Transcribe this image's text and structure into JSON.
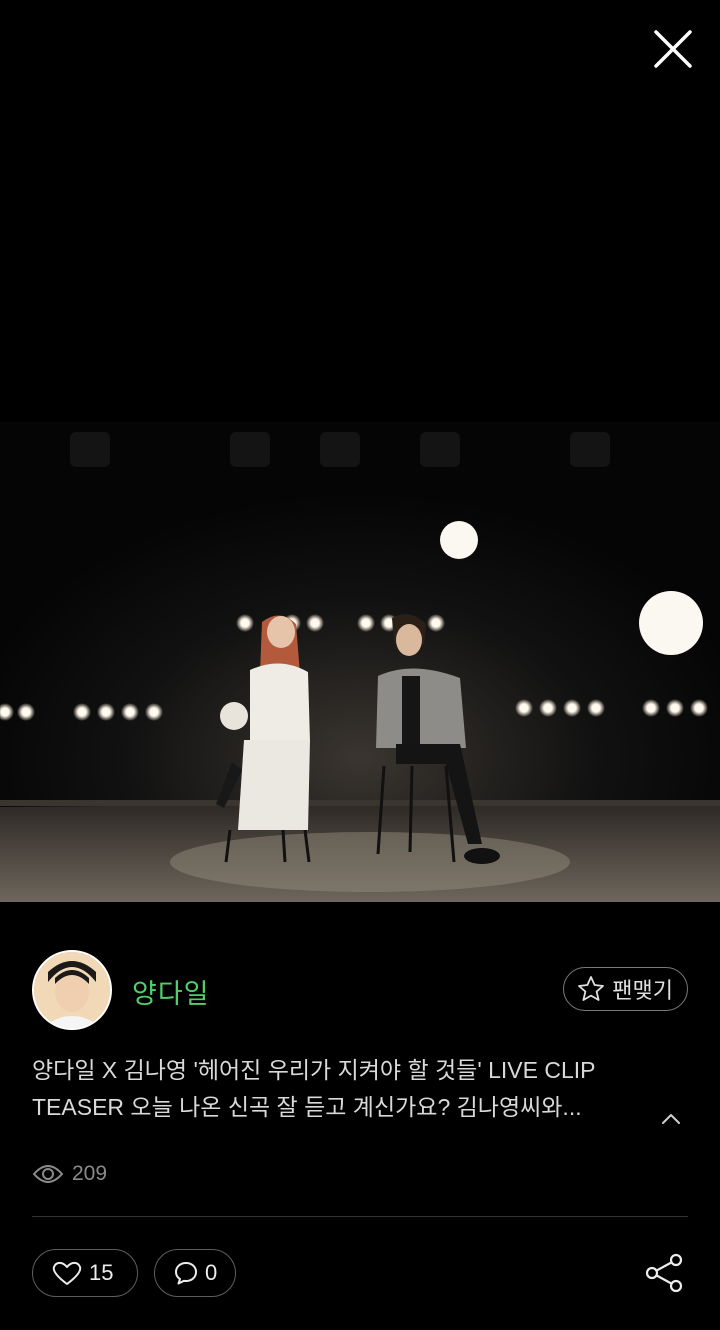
{
  "header": {
    "close_icon": "close-icon"
  },
  "post": {
    "author_name": "양다일",
    "follow_label": "팬맺기",
    "description_line1": "양다일 X 김나영 '헤어진 우리가 지켜야 할 것들' LIVE CLIP",
    "description_line2": "TEASER  오늘 나온 신곡 잘 듣고 계신가요? 김나영씨와...",
    "views": "209",
    "likes": "15",
    "comments": "0"
  },
  "colors": {
    "background": "#000000",
    "author_name": "#4fd06a",
    "text": "#d9d9d9",
    "muted": "#8a8a8a"
  },
  "icons": [
    "close-icon",
    "star-icon",
    "chevron-up-icon",
    "eye-icon",
    "heart-icon",
    "comment-icon",
    "share-icon"
  ]
}
